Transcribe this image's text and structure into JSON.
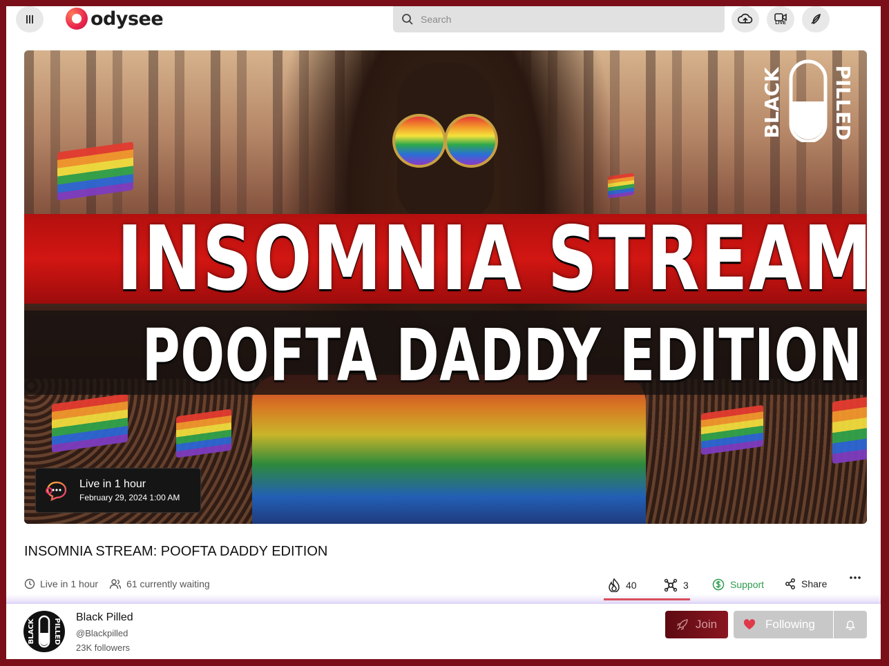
{
  "header": {
    "logo_text": "odysee",
    "search_placeholder": "Search",
    "live_label": "LIVE",
    "icons": [
      "menu-icon",
      "search-icon",
      "upload-icon",
      "go-live-icon",
      "publish-post-icon"
    ]
  },
  "thumbnail": {
    "headline_line1": "INSOMNIA STREAM",
    "headline_line2": "POOFTA DADDY EDITION",
    "badge_text": [
      "BLACK",
      "PILLED"
    ],
    "live_status": "Live in 1 hour",
    "live_date": "February 29, 2024 1:00 AM"
  },
  "video": {
    "title": "INSOMNIA STREAM: POOFTA DADDY EDITION",
    "meta_live": "Live in 1 hour",
    "meta_waiting": "61 currently waiting"
  },
  "actions": {
    "fire_count": "40",
    "slime_count": "3",
    "support_label": "Support",
    "share_label": "Share",
    "fire_ratio": 0.93
  },
  "channel": {
    "name": "Black Pilled",
    "handle": "@Blackpilled",
    "followers": "23K followers",
    "join_label": "Join",
    "following_label": "Following"
  },
  "colors": {
    "page_border": "#7a0f1a",
    "support_green": "#2c9b4d",
    "fire_red": "#e02828",
    "join_bg": "#7a1220",
    "heart": "#e0394a"
  }
}
